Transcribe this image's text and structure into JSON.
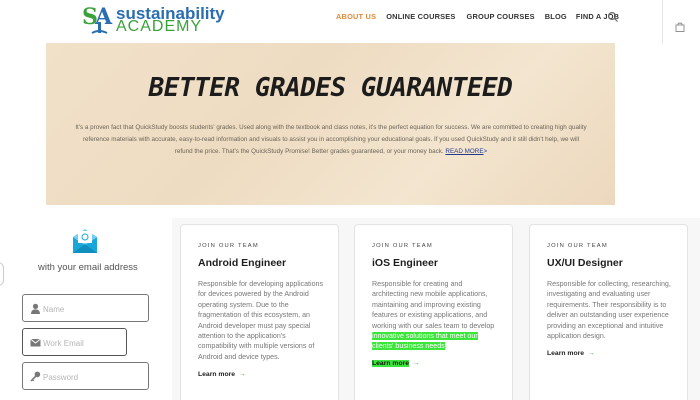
{
  "header": {
    "logo_line1": "sustainability",
    "logo_line2": "ACADEMY",
    "nav": [
      {
        "label": "ABOUT US",
        "active": true
      },
      {
        "label": "ONLINE COURSES",
        "active": false
      },
      {
        "label": "GROUP COURSES",
        "active": false
      },
      {
        "label": "BLOG",
        "active": false
      },
      {
        "label": "FIND A JOB",
        "active": false
      }
    ],
    "search_icon": "search-icon",
    "cart_icon": "shopping-bag-icon"
  },
  "hero": {
    "title": "BETTER GRADES GUARANTEED",
    "body": "It's a proven fact that QuickStudy boosts students' grades. Used along with the textbook and class notes, it's the perfect equation for success. We are committed to creating high quality reference materials with accurate, easy-to-read information and visuals to assist you in accomplishing your educational goals. If you used QuickStudy and it still didn't help, we will refund the price. That's the QuickStudy Promise! Better grades guaranteed, or your money back.",
    "link": "READ MORE"
  },
  "signup": {
    "caption": "with your email address",
    "fields": [
      {
        "placeholder": "Name",
        "icon": "user-icon"
      },
      {
        "placeholder": "Work Email",
        "icon": "mail-icon"
      },
      {
        "placeholder": "Password",
        "icon": "key-icon"
      }
    ]
  },
  "cards": [
    {
      "eyebrow": "JOIN OUR TEAM",
      "title": "Android Engineer",
      "description": "Responsible for developing applications for devices powered by the Android operating system. Due to the fragmentation of this ecosystem, an Android developer must pay special attention to the application's compatibility with multiple versions of Android and device types.",
      "learn": "Learn more"
    },
    {
      "eyebrow": "JOIN OUR TEAM",
      "title": "iOS Engineer",
      "description_pre": "Responsible for creating and architecting new mobile applications, maintaining and improving existing features or existing applications, and working with our sales team to develop ",
      "description_highlight": "innovative solutions that meet our clients' business needs",
      "description_post": ".",
      "learn": "Learn more"
    },
    {
      "eyebrow": "JOIN OUR TEAM",
      "title": "UX/UI Designer",
      "description": "Responsible for collecting, researching, investigating and evaluating user requirements. Their responsibility is to deliver an outstanding user experience providing an exceptional and intuitive application design.",
      "learn": "Learn more"
    }
  ],
  "colors": {
    "accent": "#e08a3c",
    "brand_blue": "#2a6db0",
    "brand_green": "#3aa13a",
    "highlight": "#3be63b"
  }
}
